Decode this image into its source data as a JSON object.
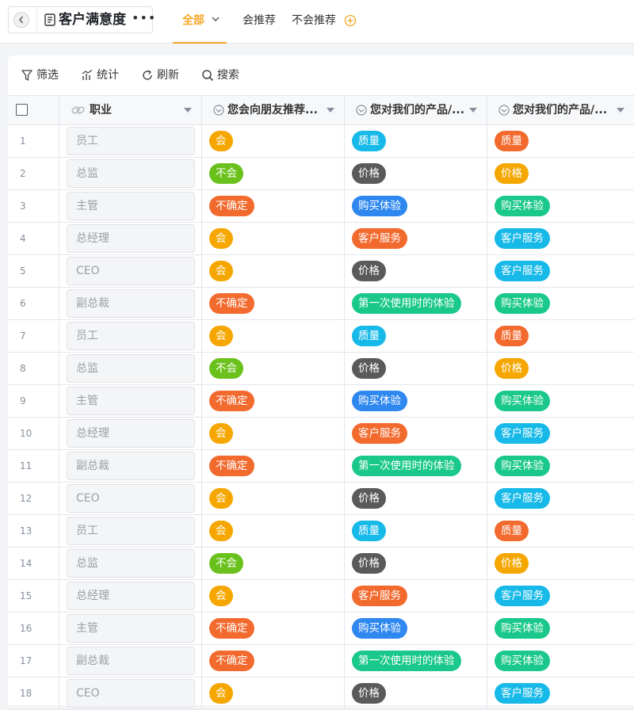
{
  "header": {
    "title": "客户满意度",
    "more": "•••",
    "tabs": [
      {
        "label": "全部",
        "active": true
      },
      {
        "label": "会推荐",
        "active": false
      },
      {
        "label": "不会推荐",
        "active": false
      }
    ],
    "accent_color": "#f5a623"
  },
  "toolbar": {
    "filter": "筛选",
    "stats": "统计",
    "refresh": "刷新",
    "search": "搜索"
  },
  "columns": [
    {
      "label": "职业",
      "icon": "link-icon"
    },
    {
      "label": "您会向朋友推荐...",
      "icon": "select-icon"
    },
    {
      "label": "您对我们的产品/...",
      "icon": "select-icon"
    },
    {
      "label": "您对我们的产品/...",
      "icon": "select-icon"
    }
  ],
  "tag_colors": {
    "会": "#f5a700",
    "不会": "#6ac11b",
    "不确定": "#f26a2e",
    "质量": "#16b9e8",
    "价格": "#5a5a5a",
    "购买体验": "#2f87f0",
    "客户服务": "#f26a2e",
    "第一次使用时的体验": "#19c88a"
  },
  "tag_colors_col3": {
    "质量": "#f26a2e",
    "价格": "#f5a700",
    "购买体验": "#19c88a",
    "客户服务": "#16b9e8"
  },
  "rows": [
    {
      "num": "1",
      "job": "员工",
      "rec": "会",
      "p1": "质量",
      "p2": "质量"
    },
    {
      "num": "2",
      "job": "总监",
      "rec": "不会",
      "p1": "价格",
      "p2": "价格"
    },
    {
      "num": "3",
      "job": "主管",
      "rec": "不确定",
      "p1": "购买体验",
      "p2": "购买体验"
    },
    {
      "num": "4",
      "job": "总经理",
      "rec": "会",
      "p1": "客户服务",
      "p2": "客户服务"
    },
    {
      "num": "5",
      "job": "CEO",
      "rec": "会",
      "p1": "价格",
      "p2": "客户服务"
    },
    {
      "num": "6",
      "job": "副总裁",
      "rec": "不确定",
      "p1": "第一次使用时的体验",
      "p2": "购买体验"
    },
    {
      "num": "7",
      "job": "员工",
      "rec": "会",
      "p1": "质量",
      "p2": "质量"
    },
    {
      "num": "8",
      "job": "总监",
      "rec": "不会",
      "p1": "价格",
      "p2": "价格"
    },
    {
      "num": "9",
      "job": "主管",
      "rec": "不确定",
      "p1": "购买体验",
      "p2": "购买体验"
    },
    {
      "num": "10",
      "job": "总经理",
      "rec": "会",
      "p1": "客户服务",
      "p2": "客户服务"
    },
    {
      "num": "11",
      "job": "副总裁",
      "rec": "不确定",
      "p1": "第一次使用时的体验",
      "p2": "购买体验"
    },
    {
      "num": "12",
      "job": "CEO",
      "rec": "会",
      "p1": "价格",
      "p2": "客户服务"
    },
    {
      "num": "13",
      "job": "员工",
      "rec": "会",
      "p1": "质量",
      "p2": "质量"
    },
    {
      "num": "14",
      "job": "总监",
      "rec": "不会",
      "p1": "价格",
      "p2": "价格"
    },
    {
      "num": "15",
      "job": "总经理",
      "rec": "会",
      "p1": "客户服务",
      "p2": "客户服务"
    },
    {
      "num": "16",
      "job": "主管",
      "rec": "不确定",
      "p1": "购买体验",
      "p2": "购买体验"
    },
    {
      "num": "17",
      "job": "副总裁",
      "rec": "不确定",
      "p1": "第一次使用时的体验",
      "p2": "购买体验"
    },
    {
      "num": "18",
      "job": "CEO",
      "rec": "会",
      "p1": "价格",
      "p2": "客户服务"
    }
  ]
}
